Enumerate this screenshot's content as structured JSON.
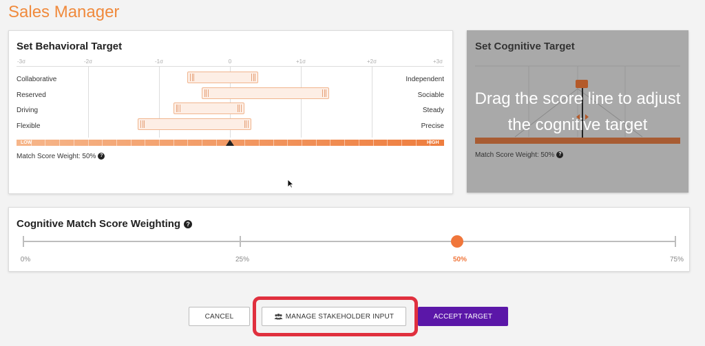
{
  "page": {
    "title": "Sales Manager"
  },
  "behavioral": {
    "title": "Set Behavioral Target",
    "sigma_labels": [
      "-3σ",
      "-2σ",
      "-1σ",
      "0",
      "+1σ",
      "+2σ",
      "+3σ"
    ],
    "traits": [
      {
        "left": "Collaborative",
        "right": "Independent",
        "range_sigma": [
          -0.6,
          0.4
        ]
      },
      {
        "left": "Reserved",
        "right": "Sociable",
        "range_sigma": [
          -0.4,
          1.4
        ]
      },
      {
        "left": "Driving",
        "right": "Steady",
        "range_sigma": [
          -0.8,
          0.2
        ]
      },
      {
        "left": "Flexible",
        "right": "Precise",
        "range_sigma": [
          -1.3,
          0.3
        ]
      }
    ],
    "scale_low": "LOW",
    "scale_high": "HIGH",
    "marker_sigma": 0,
    "weight_text": "Match Score Weight: 50%"
  },
  "cognitive": {
    "title": "Set Cognitive Target",
    "overlay_text": "Drag the score line to adjust the cognitive target",
    "weight_text": "Match Score Weight: 50%"
  },
  "weighting": {
    "title": "Cognitive Match Score Weighting",
    "stops": [
      "0%",
      "25%",
      "50%",
      "75%"
    ],
    "selected_index": 2,
    "value_percent": 50
  },
  "actions": {
    "cancel": "CANCEL",
    "manage": "MANAGE STAKEHOLDER INPUT",
    "accept": "ACCEPT TARGET"
  },
  "colors": {
    "brand_orange": "#f08a3c",
    "primary_purple": "#5b17a8",
    "highlight_red": "#e0303e"
  }
}
